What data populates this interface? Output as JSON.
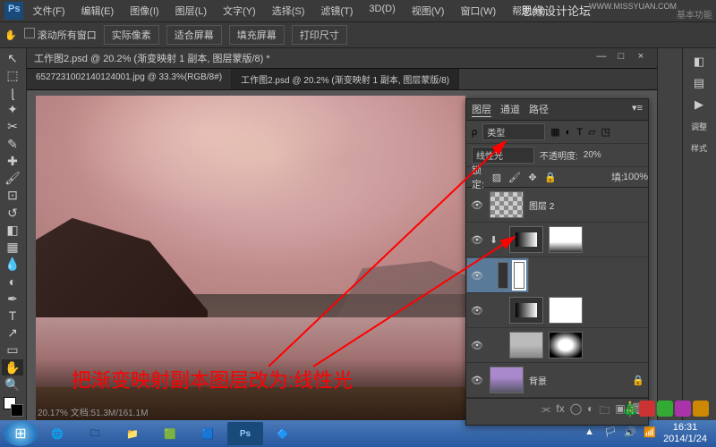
{
  "watermark": "思缘设计论坛",
  "watermark_url": "WWW.MISSYUAN.COM",
  "top_right_label": "基本功能",
  "menu": {
    "file": "文件(F)",
    "edit": "编辑(E)",
    "image": "图像(I)",
    "layer": "图层(L)",
    "text": "文字(Y)",
    "select": "选择(S)",
    "filter": "滤镜(T)",
    "threed": "3D(D)",
    "view": "视图(V)",
    "window": "窗口(W)",
    "help": "帮助(H)"
  },
  "toolbar2": {
    "scroll_all": "滚动所有窗口",
    "actual": "实际像素",
    "fit": "适合屏幕",
    "fill": "填充屏幕",
    "print": "打印尺寸"
  },
  "tabs": {
    "t1": "6527231002140124001.jpg @ 33.3%(RGB/8#)",
    "t2": "工作图2.psd @ 20.2% (渐变映射 1 副本, 图层蒙版/8)"
  },
  "doc_title": "工作图2.psd @ 20.2% (渐变映射 1 副本, 图层蒙版/8) *",
  "status": "20.17%   文档:51.3M/161.1M",
  "layers_panel": {
    "tab1": "图层",
    "tab2": "通道",
    "tab3": "路径",
    "kind": "类型",
    "blend": "线性光",
    "opacity_label": "不透明度:",
    "opacity_value": "20%",
    "lock": "锁定:",
    "fill_label": "填:",
    "fill_value": "100%",
    "l1": "图层 2",
    "l_bg": "背景"
  },
  "annotation": "把渐变映射副本图层改为:线性光",
  "taskbar": {
    "time": "16:31",
    "date": "2014/1/24"
  }
}
